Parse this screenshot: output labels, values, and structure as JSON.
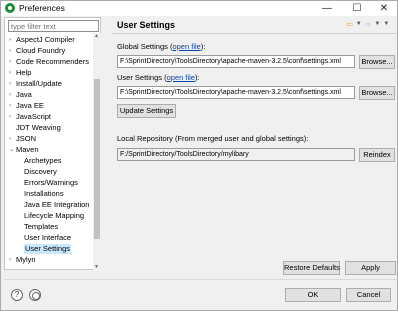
{
  "window": {
    "title": "Preferences"
  },
  "filter": {
    "placeholder": "type filter text"
  },
  "tree": [
    {
      "label": "AspectJ Compiler",
      "twisty": "›",
      "indent": 0
    },
    {
      "label": "Cloud Foundry",
      "twisty": "›",
      "indent": 0
    },
    {
      "label": "Code Recommenders",
      "twisty": "›",
      "indent": 0
    },
    {
      "label": "Help",
      "twisty": "›",
      "indent": 0
    },
    {
      "label": "Install/Update",
      "twisty": "›",
      "indent": 0
    },
    {
      "label": "Java",
      "twisty": "›",
      "indent": 0
    },
    {
      "label": "Java EE",
      "twisty": "›",
      "indent": 0
    },
    {
      "label": "JavaScript",
      "twisty": "›",
      "indent": 0
    },
    {
      "label": "JDT Weaving",
      "twisty": "",
      "indent": 0
    },
    {
      "label": "JSON",
      "twisty": "›",
      "indent": 0
    },
    {
      "label": "Maven",
      "twisty": "⌄",
      "indent": 0
    },
    {
      "label": "Archetypes",
      "twisty": "",
      "indent": 1
    },
    {
      "label": "Discovery",
      "twisty": "",
      "indent": 1
    },
    {
      "label": "Errors/Warnings",
      "twisty": "",
      "indent": 1
    },
    {
      "label": "Installations",
      "twisty": "",
      "indent": 1
    },
    {
      "label": "Java EE Integration",
      "twisty": "",
      "indent": 1
    },
    {
      "label": "Lifecycle Mapping",
      "twisty": "",
      "indent": 1
    },
    {
      "label": "Templates",
      "twisty": "",
      "indent": 1
    },
    {
      "label": "User Interface",
      "twisty": "",
      "indent": 1
    },
    {
      "label": "User Settings",
      "twisty": "",
      "indent": 1,
      "selected": true
    },
    {
      "label": "Mylyn",
      "twisty": "›",
      "indent": 0
    }
  ],
  "page": {
    "title": "User Settings",
    "global_label": "Global Settings",
    "global_link": "open file",
    "global_value": "F:\\SprintDirectory\\ToolsDirectory\\apache-maven-3.2.5\\conf\\settings.xml",
    "user_label": "User Settings",
    "user_link": "open file",
    "user_value": "F:\\SprintDirectory\\ToolsDirectory\\apache-maven-3.2.5\\conf\\settings.xml",
    "browse_label": "Browse...",
    "update_label": "Update Settings",
    "repo_label": "Local Repository (From merged user and global settings):",
    "repo_value": "F:/SprintDirectory/ToolsDirectory/mylibary",
    "reindex_label": "Reindex",
    "restore_label": "Restore Defaults",
    "apply_label": "Apply"
  },
  "footer": {
    "ok_label": "OK",
    "cancel_label": "Cancel"
  },
  "icons": {
    "app": "eclipse-icon",
    "back": "arrow-left-icon",
    "forward": "arrow-right-icon",
    "menu": "chevron-down-icon",
    "help": "help-icon",
    "link": "link-prefs-icon"
  }
}
